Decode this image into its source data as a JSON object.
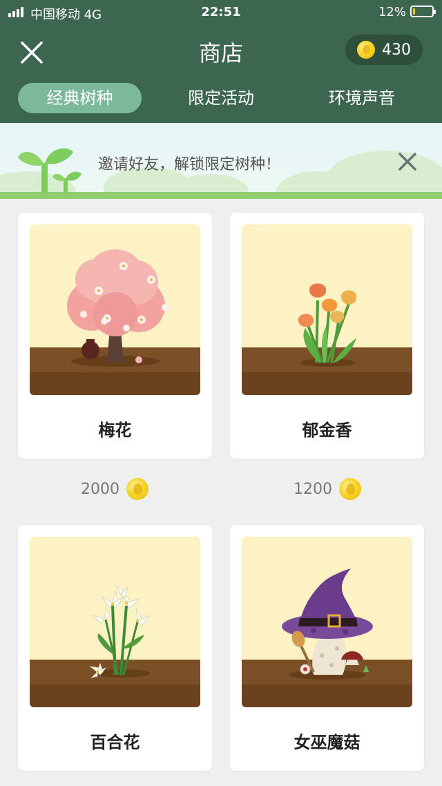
{
  "status_bar": {
    "carrier": "中国移动  4G",
    "time": "22:51",
    "battery": "12%",
    "battery_level": 0.12
  },
  "header": {
    "title": "商店",
    "coins": "430",
    "close_icon": "close-icon",
    "coin_icon": "coin-icon"
  },
  "tabs": [
    {
      "label": "经典树种",
      "active": true
    },
    {
      "label": "限定活动",
      "active": false
    },
    {
      "label": "环境声音",
      "active": false
    }
  ],
  "banner": {
    "text": "邀请好友，解锁限定树种！",
    "close_icon": "close-icon",
    "sprout_icon": "sprout-icon"
  },
  "items": [
    {
      "name": "梅花",
      "price": "2000",
      "art": "plum-blossom-tree"
    },
    {
      "name": "郁金香",
      "price": "1200",
      "art": "tulips"
    },
    {
      "name": "百合花",
      "art": "lilies"
    },
    {
      "name": "女巫魔菇",
      "art": "witch-mushroom"
    }
  ],
  "colors": {
    "header_green": "#3d6650",
    "tab_active": "#7cb89a",
    "card_bg": "#fdf2c4",
    "soil": "#7b5026",
    "coin": "#f6d528"
  }
}
